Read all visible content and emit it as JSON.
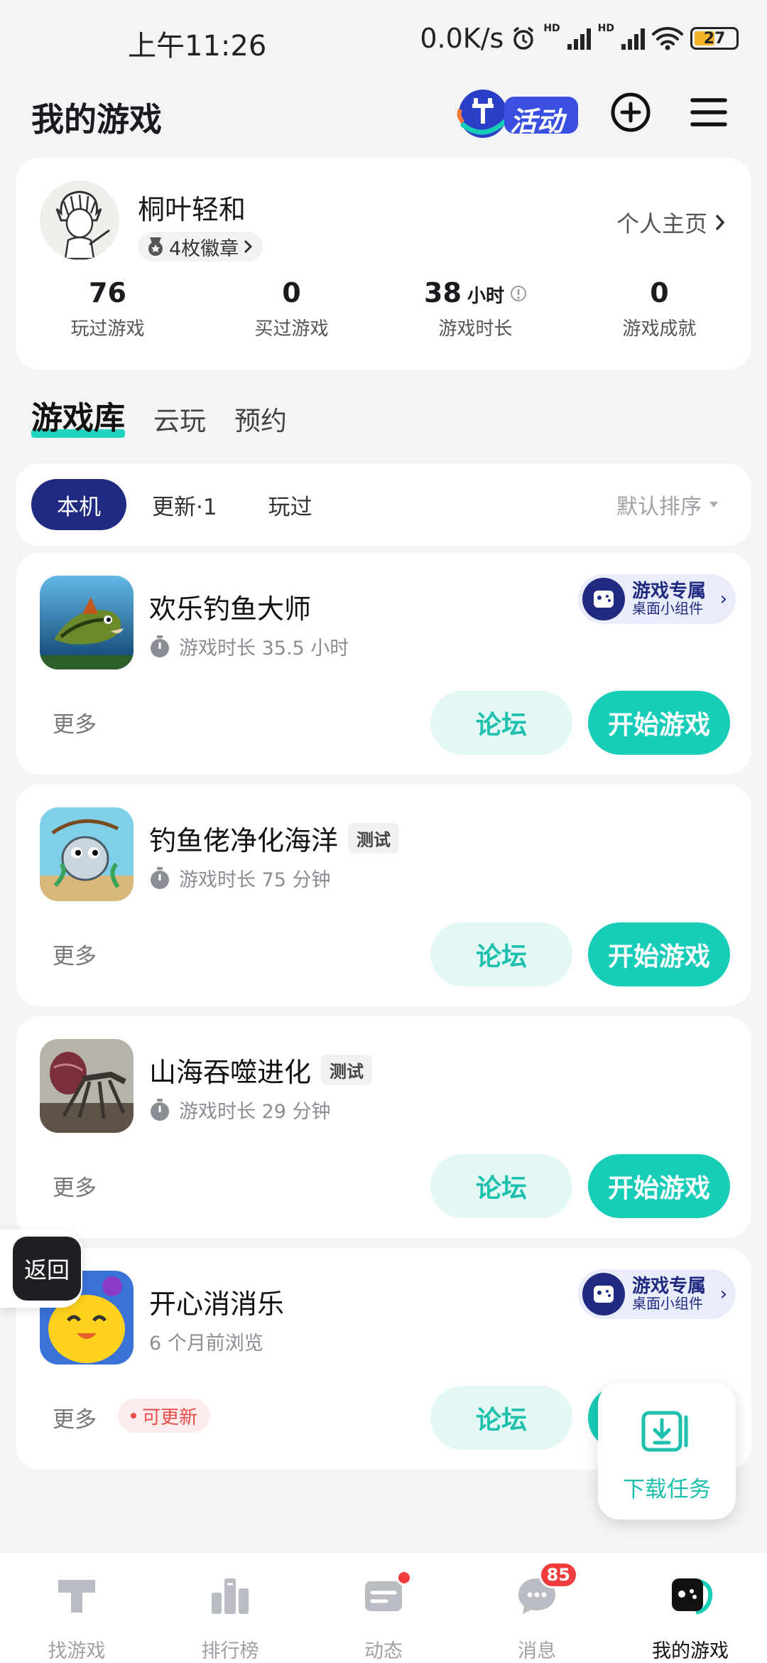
{
  "status_bar": {
    "time": "上午11:26",
    "net_speed": "0.0K/s",
    "network_1": "HD",
    "network_2": "HD",
    "battery": "27"
  },
  "header": {
    "title": "我的游戏",
    "activity_label": "活动"
  },
  "profile": {
    "username": "桐叶轻和",
    "badges": "4枚徽章",
    "homepage": "个人主页",
    "stats": [
      {
        "value": "76",
        "unit": "",
        "label": "玩过游戏"
      },
      {
        "value": "0",
        "unit": "",
        "label": "买过游戏"
      },
      {
        "value": "38",
        "unit": "小时",
        "label": "游戏时长"
      },
      {
        "value": "0",
        "unit": "",
        "label": "游戏成就"
      }
    ]
  },
  "section_tabs": [
    "游戏库",
    "云玩",
    "预约"
  ],
  "filters": {
    "chips": [
      "本机",
      "更新·1",
      "玩过"
    ],
    "sort": "默认排序"
  },
  "games": [
    {
      "name": "欢乐钓鱼大师",
      "tag": "",
      "sub": "游戏时长 35.5 小时",
      "widget": true,
      "update": false
    },
    {
      "name": "钓鱼佬净化海洋",
      "tag": "测试",
      "sub": "游戏时长 75 分钟",
      "widget": false,
      "update": false
    },
    {
      "name": "山海吞噬进化",
      "tag": "测试",
      "sub": "游戏时长 29 分钟",
      "widget": false,
      "update": false
    },
    {
      "name": "开心消消乐",
      "tag": "",
      "sub": "6 个月前浏览",
      "widget": true,
      "update": true
    }
  ],
  "game_actions": {
    "more": "更多",
    "forum": "论坛",
    "play": "开始游戏",
    "update_tag": "可更新"
  },
  "widget": {
    "title": "游戏专属",
    "subtitle": "桌面小组件"
  },
  "floating": {
    "back": "返回",
    "download": "下载任务"
  },
  "bottom_nav": [
    {
      "label": "找游戏",
      "icon": "find-games-icon"
    },
    {
      "label": "排行榜",
      "icon": "ranking-icon"
    },
    {
      "label": "动态",
      "icon": "feed-icon"
    },
    {
      "label": "消息",
      "icon": "message-icon",
      "badge": "85"
    },
    {
      "label": "我的游戏",
      "icon": "my-games-icon"
    }
  ],
  "colors": {
    "accent": "#18cdb7",
    "navy": "#1f2a80",
    "alert": "#f03c3c"
  }
}
